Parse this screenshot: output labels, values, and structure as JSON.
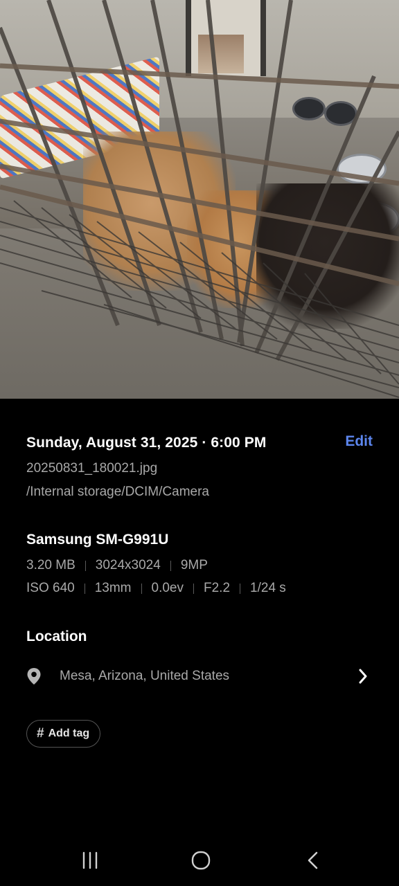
{
  "photo": {
    "icon": "photo-kennel-dogs"
  },
  "details": {
    "date_time": "Sunday, August 31, 2025 · 6:00 PM",
    "edit_label": "Edit",
    "filename": "20250831_180021.jpg",
    "path": "/Internal storage/DCIM/Camera",
    "device": "Samsung SM-G991U",
    "file_info": [
      "3.20 MB",
      "3024x3024",
      "9MP"
    ],
    "camera_info": [
      "ISO 640",
      "13mm",
      "0.0ev",
      "F2.2",
      "1/24 s"
    ],
    "location_title": "Location",
    "location": "Mesa, Arizona, United States",
    "add_tag_label": "Add tag"
  },
  "colors": {
    "background": "#000000",
    "accent": "#5c86ee",
    "secondary_text": "#a9a9a9"
  },
  "navbar": {
    "icons": [
      "recents-icon",
      "home-icon",
      "back-icon"
    ]
  }
}
